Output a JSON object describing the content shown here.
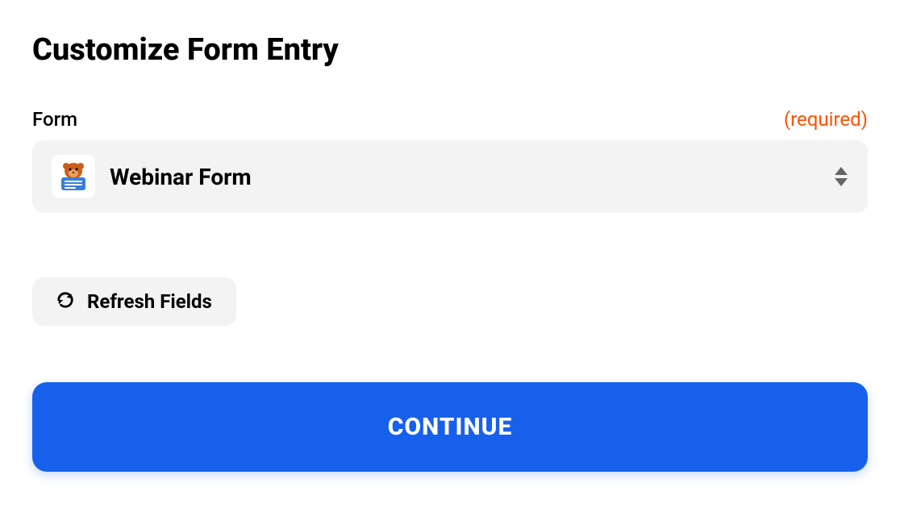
{
  "header": {
    "title": "Customize Form Entry"
  },
  "formField": {
    "label": "Form",
    "requiredTag": "(required)",
    "selectedValue": "Webinar Form"
  },
  "refresh": {
    "label": "Refresh Fields"
  },
  "continue": {
    "label": "CONTINUE"
  },
  "colors": {
    "primary": "#1760ec",
    "required": "#ff5100",
    "inputBg": "#f3f3f3"
  }
}
